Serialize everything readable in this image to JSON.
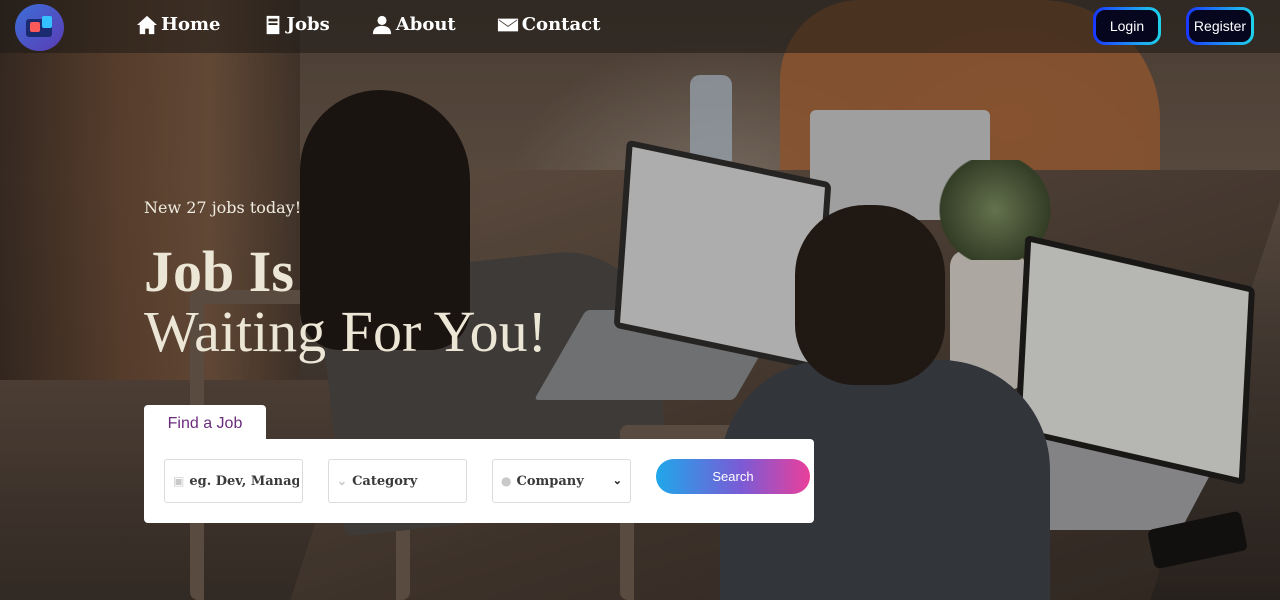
{
  "nav": {
    "items": [
      {
        "label": "Home",
        "icon": "home-icon"
      },
      {
        "label": "Jobs",
        "icon": "book-icon"
      },
      {
        "label": "About",
        "icon": "user-icon"
      },
      {
        "label": "Contact",
        "icon": "envelope-icon"
      }
    ],
    "login_label": "Login",
    "register_label": "Register"
  },
  "hero": {
    "subtitle": "New 27 jobs today!",
    "title_line1": "Job Is",
    "title_line2": "Waiting For You!"
  },
  "search": {
    "tab_label": "Find a Job",
    "keyword_placeholder": "eg. Dev, Manager",
    "category_value": "Category",
    "company_value": "Company",
    "button_label": "Search"
  },
  "colors": {
    "tab_text": "#6a2d7d",
    "search_gradient": [
      "#1fa7ea",
      "#ea3f9a"
    ],
    "nav_button_border": [
      "#1a36ff",
      "#1fd3ea"
    ]
  }
}
